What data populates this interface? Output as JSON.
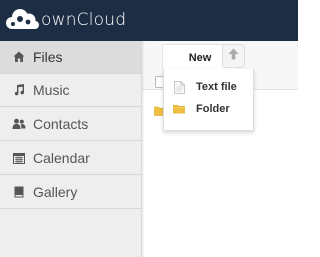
{
  "header": {
    "brand": "ownCloud",
    "logo_icon": "cloud-logo-icon",
    "background": "#1d2d44"
  },
  "sidebar": {
    "items": [
      {
        "label": "Files",
        "icon": "home-icon",
        "active": true
      },
      {
        "label": "Music",
        "icon": "music-note-icon",
        "active": false
      },
      {
        "label": "Contacts",
        "icon": "people-icon",
        "active": false
      },
      {
        "label": "Calendar",
        "icon": "calendar-icon",
        "active": false
      },
      {
        "label": "Gallery",
        "icon": "image-icon",
        "active": false
      }
    ]
  },
  "toolbar": {
    "new_label": "New",
    "upload_icon": "upload-arrow-icon"
  },
  "new_menu": {
    "items": [
      {
        "label": "Text file",
        "icon": "text-file-icon"
      },
      {
        "label": "Folder",
        "icon": "folder-icon"
      }
    ]
  },
  "colors": {
    "accent_folder": "#f0c040",
    "sidebar_bg": "#eeeeee",
    "sidebar_active_bg": "#dcdcdc"
  }
}
